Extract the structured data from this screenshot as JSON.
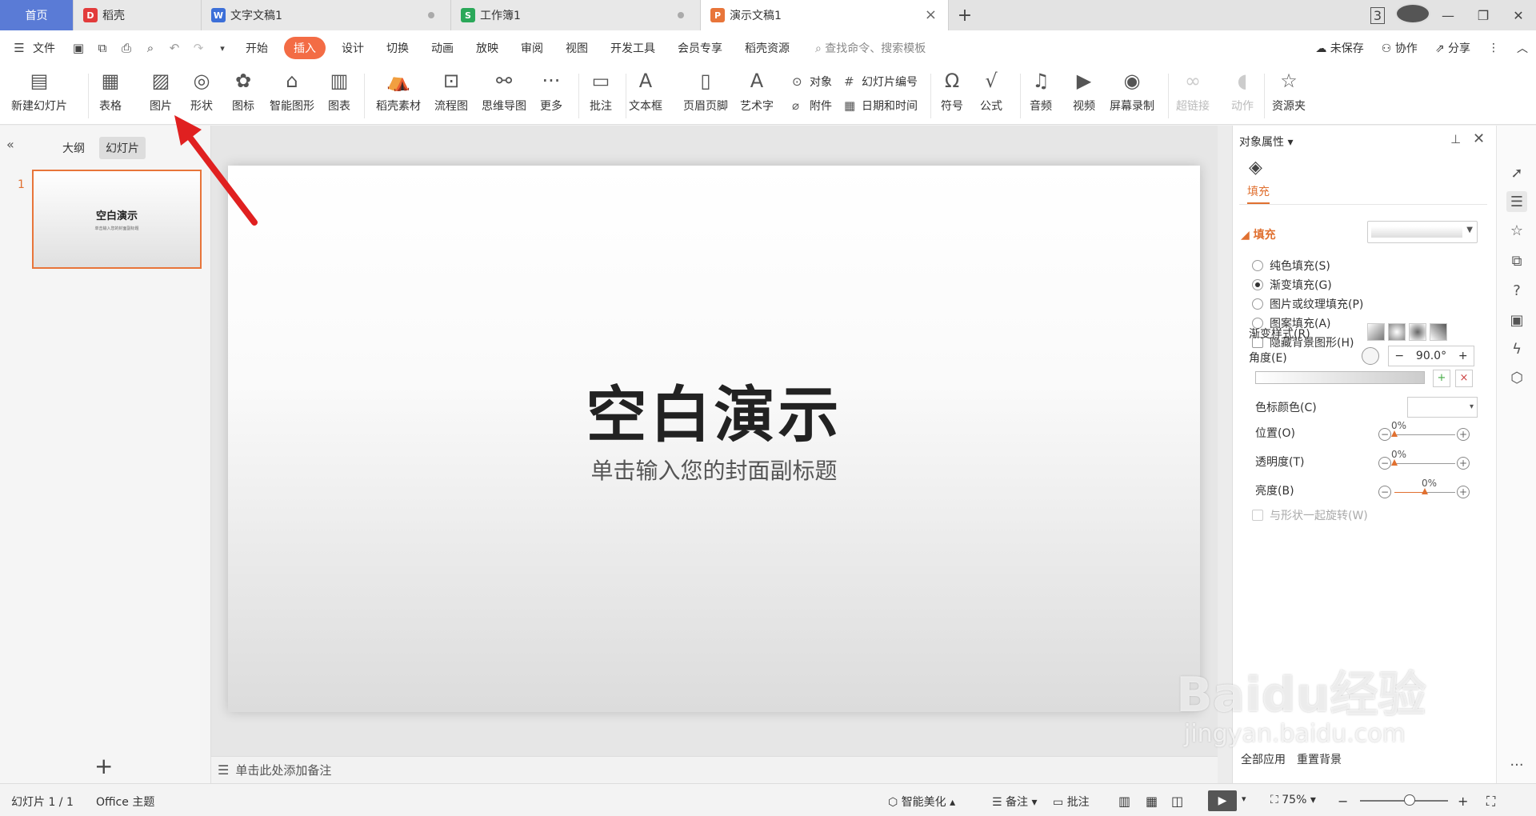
{
  "tabs": [
    {
      "label": "首页"
    },
    {
      "label": "稻壳"
    },
    {
      "label": "文字文稿1"
    },
    {
      "label": "工作簿1"
    },
    {
      "label": "演示文稿1"
    }
  ],
  "window": {
    "badge": "3"
  },
  "menu": {
    "file": "文件",
    "items": [
      "开始",
      "插入",
      "设计",
      "切换",
      "动画",
      "放映",
      "审阅",
      "视图",
      "开发工具",
      "会员专享",
      "稻壳资源"
    ],
    "search_placeholder": "查找命令、搜索模板",
    "unsaved": "未保存",
    "collab": "协作",
    "share": "分享"
  },
  "ribbon": {
    "new_slide": "新建幻灯片",
    "table": "表格",
    "picture": "图片",
    "shape": "形状",
    "icon": "图标",
    "smartart": "智能图形",
    "chart": "图表",
    "docer_material": "稻壳素材",
    "flowchart": "流程图",
    "mindmap": "思维导图",
    "more": "更多",
    "comment": "批注",
    "textbox": "文本框",
    "header_footer": "页眉页脚",
    "wordart": "艺术字",
    "object": "对象",
    "slide_number": "幻灯片编号",
    "attachment": "附件",
    "datetime": "日期和时间",
    "symbol": "符号",
    "formula": "公式",
    "audio": "音频",
    "video": "视频",
    "screen_record": "屏幕录制",
    "hyperlink": "超链接",
    "action": "动作",
    "resource": "资源夹"
  },
  "left_panel": {
    "tab_outline": "大纲",
    "tab_slides": "幻灯片",
    "slide_index": "1",
    "thumb_title": "空白演示",
    "thumb_sub": "单击输入您的封面副标题"
  },
  "slide": {
    "title": "空白演示",
    "subtitle": "单击输入您的封面副标题"
  },
  "notes": {
    "placeholder": "单击此处添加备注"
  },
  "properties": {
    "header": "对象属性",
    "tab_fill": "填充",
    "section_fill": "填充",
    "solid_fill": "纯色填充(S)",
    "gradient_fill": "渐变填充(G)",
    "picture_fill": "图片或纹理填充(P)",
    "pattern_fill": "图案填充(A)",
    "hide_bg": "隐藏背景图形(H)",
    "gradient_style": "渐变样式(R)",
    "angle_label": "角度(E)",
    "angle_value": "90.0°",
    "color_stop": "色标颜色(C)",
    "position_label": "位置(O)",
    "position_value": "0%",
    "transparency_label": "透明度(T)",
    "transparency_value": "0%",
    "brightness_label": "亮度(B)",
    "brightness_value": "0%",
    "rotate_with_shape": "与形状一起旋转(W)",
    "apply_all": "全部应用",
    "reset_bg": "重置背景",
    "position_level": 0,
    "transparency_level": 0,
    "brightness_level": 0.5
  },
  "status": {
    "slide_info": "幻灯片 1 / 1",
    "theme": "Office 主题",
    "beautify": "智能美化",
    "notes": "备注",
    "comment": "批注",
    "zoom": "75%"
  },
  "watermark": {
    "brand": "Baidu经验",
    "url": "jingyan.baidu.com"
  },
  "colors": {
    "accent": "#f36c45",
    "home_tab": "#5a7bd6",
    "arrow": "#e02020"
  }
}
